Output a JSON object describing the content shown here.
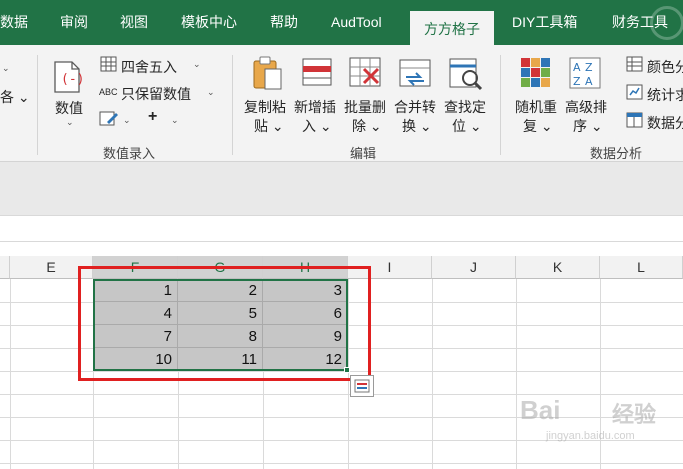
{
  "tabs": [
    {
      "label": "数据",
      "active": false
    },
    {
      "label": "审阅",
      "active": false
    },
    {
      "label": "视图",
      "active": false
    },
    {
      "label": "模板中心",
      "active": false
    },
    {
      "label": "帮助",
      "active": false
    },
    {
      "label": "AudTool",
      "active": false
    },
    {
      "label": "方方格子",
      "active": true
    },
    {
      "label": "DIY工具箱",
      "active": false
    },
    {
      "label": "财务工具",
      "active": false
    }
  ],
  "ribbon": {
    "left_partial": {
      "chev1": "⌄",
      "text": "各 ⌄"
    },
    "value_group": {
      "big_button": {
        "line1": "数值",
        "line2": "⌄"
      },
      "round_label": "四舍五入",
      "keep_label": "只保留数值",
      "keep_prefix": "ABC",
      "plus_label": "+",
      "group_label": "数值录入"
    },
    "edit_group": {
      "copy": {
        "line1": "复制粘",
        "line2": "贴 ⌄"
      },
      "insert": {
        "line1": "新增插",
        "line2": "入 ⌄"
      },
      "delete": {
        "line1": "批量删",
        "line2": "除 ⌄"
      },
      "merge": {
        "line1": "合并转",
        "line2": "换 ⌄"
      },
      "find": {
        "line1": "查找定",
        "line2": "位 ⌄"
      },
      "group_label": "编辑"
    },
    "analysis_group": {
      "random": {
        "line1": "随机重",
        "line2": "复 ⌄"
      },
      "sort": {
        "line1": "高级排",
        "line2": "序 ⌄"
      },
      "color": "颜色分",
      "stats": "统计求",
      "data": "数据分",
      "group_label": "数据分析"
    }
  },
  "sheet": {
    "columns": [
      "E",
      "F",
      "G",
      "H",
      "I",
      "J",
      "K",
      "L"
    ],
    "selected_columns": [
      "F",
      "G",
      "H"
    ],
    "rows": [
      [
        "1",
        "2",
        "3"
      ],
      [
        "4",
        "5",
        "6"
      ],
      [
        "7",
        "8",
        "9"
      ],
      [
        "10",
        "11",
        "12"
      ]
    ],
    "selection_color": "#217346",
    "highlight_color": "#e02020"
  },
  "watermark": {
    "brand": "Bai",
    "brand_cn": "经验",
    "url": "jingyan.baidu.com"
  }
}
